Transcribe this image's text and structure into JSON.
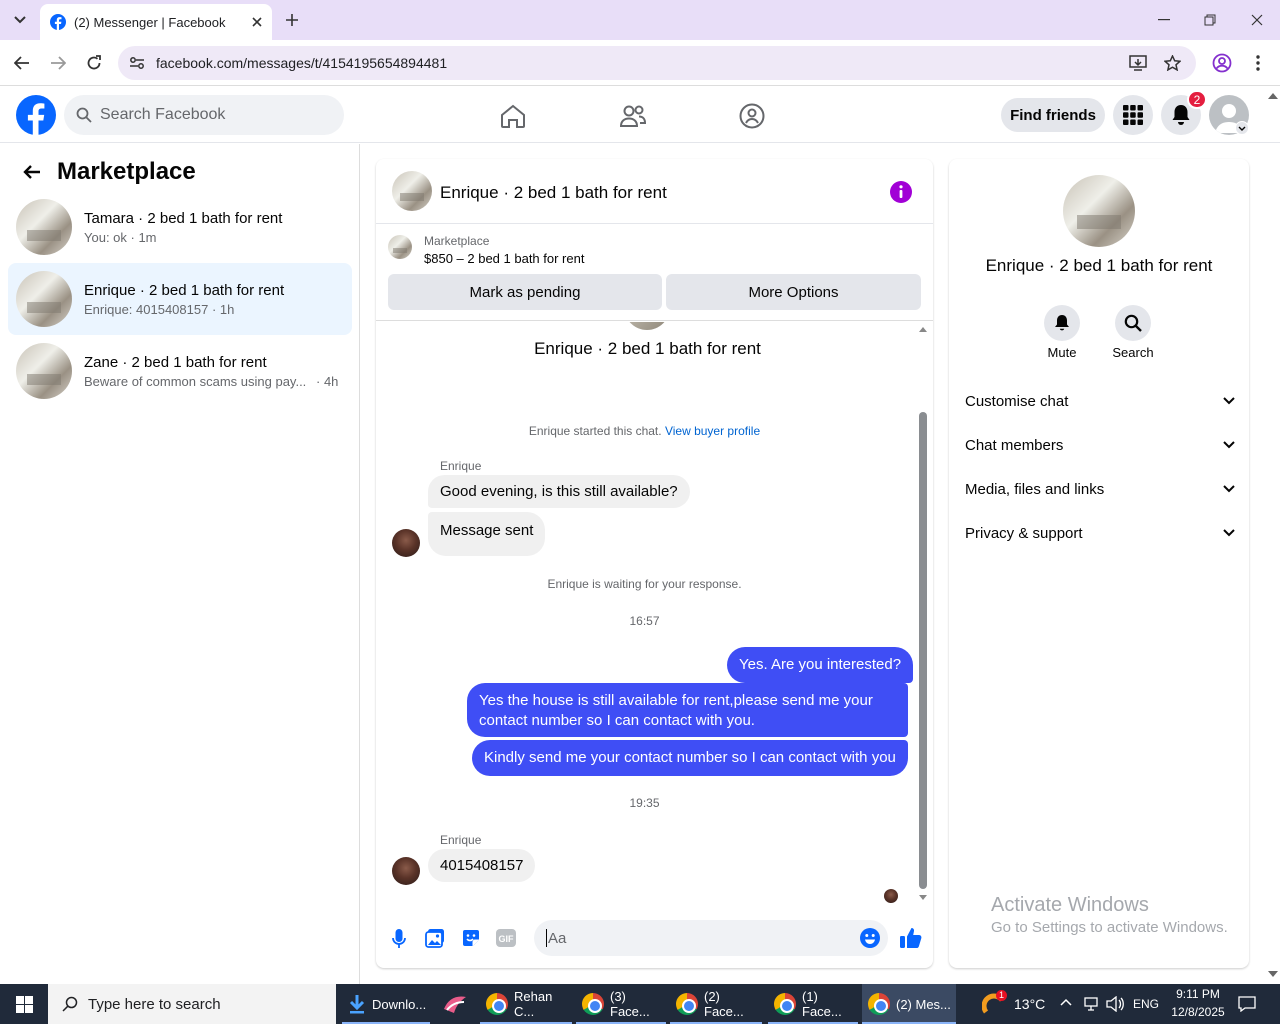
{
  "browser": {
    "tab_title": "(2) Messenger | Facebook",
    "url": "facebook.com/messages/t/4154195654894481"
  },
  "header": {
    "search_placeholder": "Search Facebook",
    "find_friends": "Find friends",
    "notification_count": "2",
    "brand_color": "#0866ff"
  },
  "sidebar": {
    "title": "Marketplace",
    "conversations": [
      {
        "name": "Tamara · 2 bed 1 bath for rent",
        "preview": "You: ok · 1m",
        "selected": false
      },
      {
        "name": "Enrique · 2 bed 1 bath for rent",
        "preview": "Enrique: 4015408157 · 1h",
        "selected": true
      },
      {
        "name": "Zane · 2 bed 1 bath for rent",
        "preview": "Beware of common scams using pay...",
        "time": "· 4h",
        "selected": false
      }
    ]
  },
  "chat": {
    "title": "Enrique · 2 bed 1 bath for rent",
    "marketplace_label": "Marketplace",
    "listing": "$850 – 2 bed 1 bath for rent",
    "mark_pending": "Mark as pending",
    "more_options": "More Options",
    "intro_title": "Enrique · 2 bed 1 bath for rent",
    "started_text": "Enrique started this chat.",
    "buyer_profile_link": "View buyer profile",
    "sender_label_1": "Enrique",
    "msg_in_1": "Good evening, is this still available?",
    "msg_in_2": "Message sent",
    "waiting_text": "Enrique is waiting for your response.",
    "time_1": "16:57",
    "msg_out_1": "Yes. Are you interested?",
    "msg_out_2": "Yes the house is still available for rent,please send me your contact number so I can contact with you.",
    "msg_out_3": "Kindly send me your contact number so I can contact with you",
    "time_2": "19:35",
    "sender_label_2": "Enrique",
    "msg_in_3": "4015408157",
    "composer_placeholder": "Aa",
    "outgoing_color": "#3f4ef5"
  },
  "details": {
    "title": "Enrique · 2 bed 1 bath for rent",
    "mute": "Mute",
    "search": "Search",
    "sections": [
      "Customise chat",
      "Chat members",
      "Media, files and links",
      "Privacy & support"
    ]
  },
  "watermark": {
    "line1": "Activate Windows",
    "line2": "Go to Settings to activate Windows."
  },
  "taskbar": {
    "search_placeholder": "Type here to search",
    "items": [
      "Downlo...",
      "Rehan C...",
      "(3) Face...",
      "(2) Face...",
      "(1) Face...",
      "(2) Mes..."
    ],
    "weather_badge": "1",
    "temperature": "13°C",
    "language": "ENG",
    "time": "9:11 PM",
    "date": "12/8/2025"
  }
}
